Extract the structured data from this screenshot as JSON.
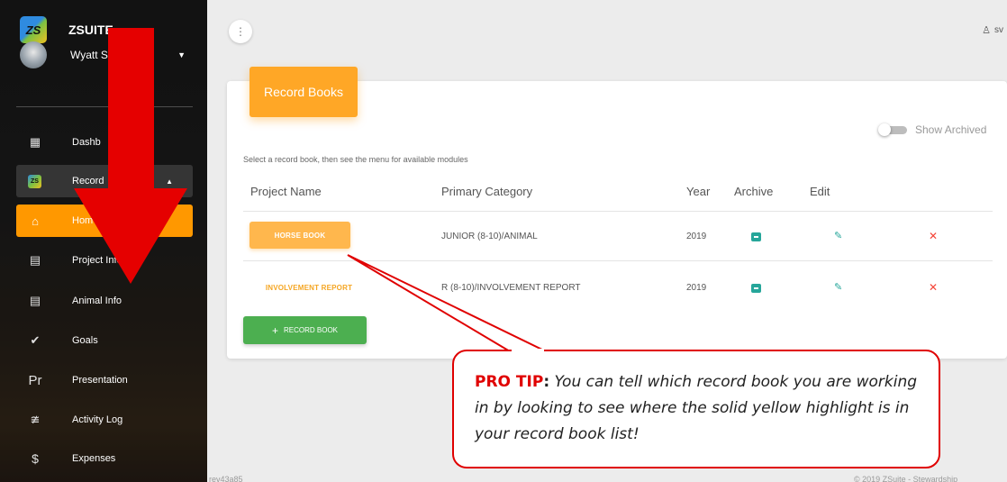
{
  "app": {
    "brand": "ZSUITE",
    "logo_text": "ZS",
    "user_name": "Wyatt S",
    "top_user": "sv"
  },
  "sidebar": {
    "items": [
      {
        "label": "Dashb",
        "icon": "dashboard-icon"
      },
      {
        "label": "Record",
        "icon": "zsuite-logo-icon"
      },
      {
        "label": "Hom",
        "icon": "home-icon"
      },
      {
        "label": "Project Info",
        "icon": "table-icon"
      },
      {
        "label": "Animal Info",
        "icon": "table-icon"
      },
      {
        "label": "Goals",
        "icon": "check-circle-icon"
      },
      {
        "label": "Presentation",
        "icon": "presentation-icon"
      },
      {
        "label": "Activity Log",
        "icon": "activity-icon"
      },
      {
        "label": "Expenses",
        "icon": "dollar-icon"
      }
    ]
  },
  "card": {
    "header": "Record Books",
    "show_archived": "Show Archived",
    "show_archived_on": false,
    "instruction": "Select a record book, then see the menu for available modules",
    "columns": [
      "Project Name",
      "Primary Category",
      "Year",
      "Archive",
      "Edit"
    ],
    "rows": [
      {
        "name": "HORSE BOOK",
        "category": "JUNIOR (8-10)/ANIMAL",
        "year": "2019",
        "selected": true
      },
      {
        "name": "INVOLVEMENT REPORT",
        "category": "R (8-10)/INVOLVEMENT REPORT",
        "year": "2019",
        "selected": false
      }
    ],
    "add_button": "RECORD BOOK"
  },
  "footer": {
    "left": "rev43a85",
    "right": "© 2019 ZSuite - Stewardship"
  },
  "annotation": {
    "tip_title": "PRO TIP",
    "tip_colon": ":",
    "tip_text": "You can tell which record book you are working in by looking to see where the solid yellow highlight is in your record book list!"
  },
  "colors": {
    "accent": "#ff9800",
    "header_orange": "#ffa726",
    "add_green": "#4caf50",
    "icon_teal": "#26a69a",
    "delete_red": "#f44336",
    "annotation_red": "#e00000"
  }
}
